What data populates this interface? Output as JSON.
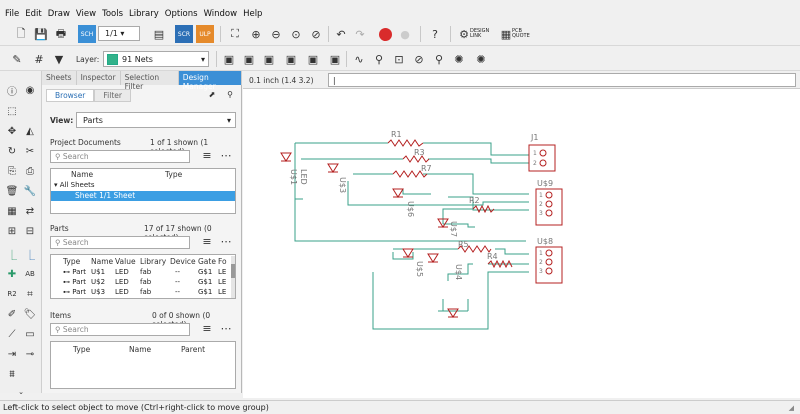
{
  "menu": [
    "File",
    "Edit",
    "Draw",
    "View",
    "Tools",
    "Library",
    "Options",
    "Window",
    "Help"
  ],
  "toolbar": {
    "sheet_select": "1/1",
    "layer_label": "Layer:",
    "layer_value": "91 Nets",
    "design_link": "DESIGN LINK",
    "pcb_quote": "PCB QUOTE",
    "scr_label": "SCR",
    "ulp_label": "ULP"
  },
  "coord_readout": "0.1 inch (1.4 3.2)",
  "panel": {
    "tabs": [
      "Sheets",
      "Inspector",
      "Selection Filter",
      "Design Manager"
    ],
    "subtabs": [
      "Browser",
      "Filter"
    ],
    "view_label": "View:",
    "view_value": "Parts",
    "project_docs": {
      "title": "Project Documents",
      "count": "1 of 1 shown (1 selected)",
      "search_placeholder": "Search",
      "columns": [
        "Name",
        "Type"
      ],
      "tree_root": "All Sheets",
      "tree_child": "Sheet 1/1 Sheet"
    },
    "parts": {
      "title": "Parts",
      "count": "17 of 17 shown (0 selected)",
      "search_placeholder": "Search",
      "columns": [
        "Type",
        "Name",
        "Value",
        "Library",
        "Device",
        "Gate",
        "Fo"
      ],
      "rows": [
        [
          "Part",
          "U$1",
          "LED",
          "fab",
          "--",
          "G$1",
          "LE"
        ],
        [
          "Part",
          "U$2",
          "LED",
          "fab",
          "--",
          "G$1",
          "LE"
        ],
        [
          "Part",
          "U$3",
          "LED",
          "fab",
          "--",
          "G$1",
          "LE"
        ]
      ]
    },
    "items": {
      "title": "Items",
      "count": "0 of 0 shown (0 selected)",
      "search_placeholder": "Search",
      "columns": [
        "Type",
        "Name",
        "Parent"
      ]
    }
  },
  "schematic": {
    "resistors": [
      "R1",
      "R3",
      "R7",
      "R2",
      "R5",
      "R4"
    ],
    "leds": [
      "U$1",
      "U$3",
      "U$6",
      "U$7",
      "U$5",
      "U$4"
    ],
    "led_value": "LED",
    "connectors": [
      "J1",
      "U$9",
      "U$8"
    ],
    "pins": [
      "1",
      "2",
      "3"
    ],
    "colors": {
      "wire": "#3aa08a",
      "part": "#b42020",
      "label": "#777777"
    }
  },
  "status": "Left-click to select object to move (Ctrl+right-click to move group)"
}
